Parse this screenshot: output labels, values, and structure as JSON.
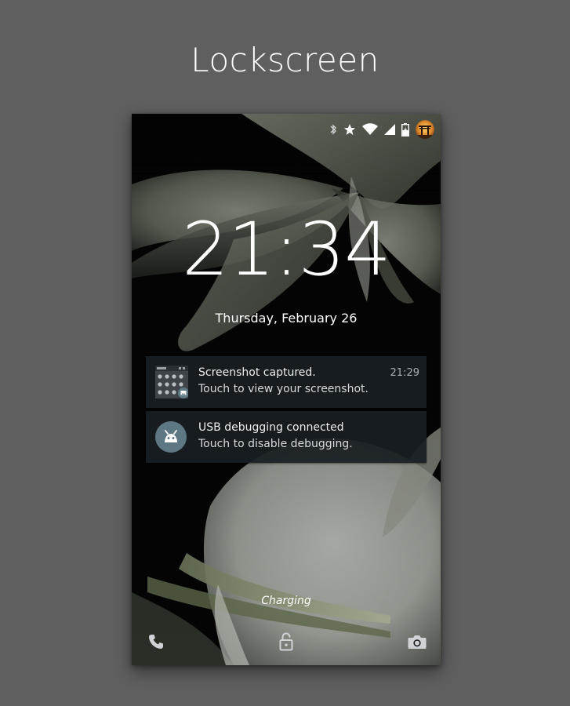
{
  "page": {
    "title": "Lockscreen"
  },
  "statusbar": {
    "icons": [
      "bluetooth-icon",
      "star-icon",
      "wifi-icon",
      "signal-icon",
      "battery-charging-icon",
      "avatar"
    ]
  },
  "lockscreen": {
    "time": "21:34",
    "date": "Thursday, February 26",
    "charging_label": "Charging"
  },
  "notifications": [
    {
      "title": "Screenshot captured.",
      "text": "Touch to view your screenshot.",
      "time": "21:29",
      "icon": "screenshot-thumbnail"
    },
    {
      "title": "USB debugging connected",
      "text": "Touch to disable debugging.",
      "icon": "android-debug-icon"
    }
  ],
  "bottom_bar": {
    "left": "phone-icon",
    "center": "unlock-icon",
    "right": "camera-icon"
  },
  "colors": {
    "frame_background": "#5f5f5f",
    "notification_background": "#191e22",
    "debug_icon_circle": "#5e7883"
  }
}
